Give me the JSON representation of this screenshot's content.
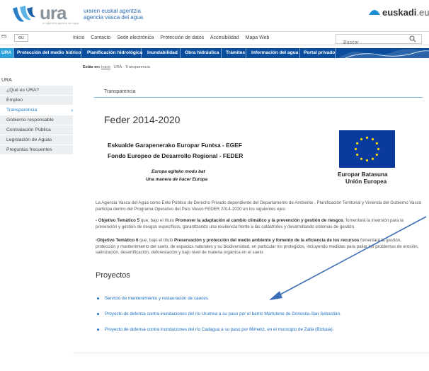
{
  "header": {
    "logo_text": "ura",
    "logo_sub": "ur agentzia agencia del agua",
    "agency_line1": "uraren euskal agentzia",
    "agency_line2": "agencia vasca del agua",
    "euskadi_brand": "euskadi",
    "euskadi_domain": ".eus"
  },
  "topnav": {
    "lang_es": "es",
    "lang_eu": "eu",
    "links": [
      "Inicio",
      "Contacto",
      "Sede electrónica",
      "Protección de datos",
      "Accesibilidad",
      "Mapa Web"
    ],
    "search_placeholder": "Buscar"
  },
  "mainnav": {
    "items": [
      "URA",
      "Protección del medio hídrico",
      "Planificación hidrológica",
      "Inundabilidad",
      "Obra hidráulica",
      "Trámites",
      "Información del agua",
      "Portal privado"
    ]
  },
  "breadcrumb": {
    "label": "Estás en:",
    "items": [
      "Inicio",
      "URA",
      "Transparencia"
    ]
  },
  "sidebar": {
    "root": "URA",
    "items": [
      "¿Qué es URA?",
      "Empleo",
      "Transparencia",
      "Gobierno responsable",
      "Contratación Pública",
      "Legislación de Aguas",
      "Preguntas frecuentes"
    ]
  },
  "content": {
    "section": "Transparencia",
    "title": "Feder 2014-2020",
    "feder_eu": "Eskualde Garapenerako Europar Funtsa - EGEF",
    "feder_es": "Fondo Europeo de Desarrollo Regional - FEDER",
    "motto_eu": "Europa egiteko modu bat",
    "motto_es": "Una manera de hacer Europa",
    "eu_label_eu": "Europar Batasuna",
    "eu_label_es": "Unión Europea",
    "p1": "La Agencia Vasca del Agua como Ente Público de Derecho Privado dependiente del Departamento de Ambiente , Planificación Territorial y Vivienda del Gobierno Vasco participa dentro del Programa Operativo del País Vasco FEDER 2014-2020 en los siguientes ejes:",
    "p2_lead": "- Objetivo Temático 5",
    "p2_mid": " que, bajo el título ",
    "p2_bold": "Promover la adaptación al cambio climático y la prevención y gestión de riesgos",
    "p2_tail": ", fomentará la inversión para la prevención y gestión de riesgos específicos, garantizando una resiliencia frente a las catástrofes y desarrollando sistemas de gestión.",
    "p3_lead": "-Objetivo Temático 6",
    "p3_mid": " que, bajo el título ",
    "p3_bold": "Preservación y protección del medio ambiente y fomento de la eficiencia de los recursos",
    "p3_tail": " fomentará la gestión, protección y mantenimiento del suelo, de espacios naturales y su biodiversidad, en particular los protegidos, incluyendo medidas para paliar los problemas de erosión, salinización, desertificación, deforestación y bajo nivel de materia orgánica en el suelo.",
    "proyectos_title": "Proyectos",
    "proyectos": [
      "Servicio de mantenimiento y restauración de cauces",
      "Proyecto de defensa contra inundaciones del río Urumea a su paso por el barrio Martutene de Donostia-San Sebastián.",
      "Proyecto de defensa contra inundaciones del río Cadagua a su paso por Mimetiz, en el municipio de Zalla (Bizkaia)."
    ]
  },
  "colors": {
    "nav_blue": "#0a4d9c",
    "nav_active": "#2aa3da",
    "link_blue": "#1b6ec2",
    "arrow": "#3d6fb8"
  }
}
